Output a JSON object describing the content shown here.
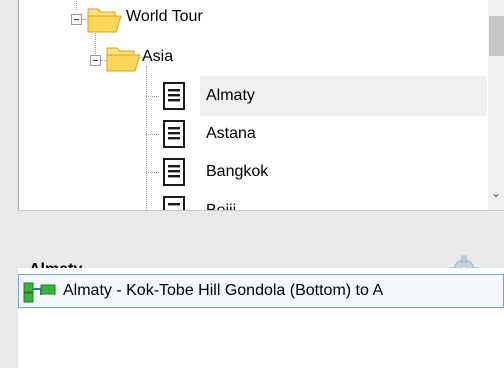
{
  "tree": {
    "items": [
      {
        "label": "World Tour",
        "type": "folder",
        "level": 0,
        "expanded": true
      },
      {
        "label": "Asia",
        "type": "folder",
        "level": 1,
        "expanded": true
      },
      {
        "label": "Almaty",
        "type": "document",
        "level": 2,
        "selected": true
      },
      {
        "label": "Astana",
        "type": "document",
        "level": 2
      },
      {
        "label": "Bangkok",
        "type": "document",
        "level": 2
      },
      {
        "label": "Beiji",
        "type": "document",
        "level": 2,
        "partially_visible": true
      }
    ]
  },
  "detail": {
    "title": "Almaty",
    "settings_icon": "gear-icon",
    "route": {
      "label": "Almaty - Kok-Tobe Hill Gondola (Bottom) to A",
      "icon": "route-icon"
    }
  },
  "colors": {
    "folder_fill": "#ffd65a",
    "folder_edge": "#d9a21a",
    "selection": "#f0f0f0",
    "route_border": "#7aa2d6",
    "route_green": "#3cb43c"
  }
}
